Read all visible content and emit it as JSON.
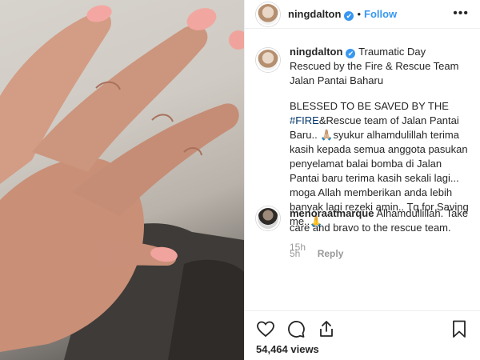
{
  "header": {
    "username": "ningdalton",
    "verified_glyph": "✔",
    "separator": "•",
    "follow_label": "Follow",
    "more_label": "•••"
  },
  "caption": {
    "username": "ningdalton",
    "verified_glyph": "✔",
    "title": "Traumatic Day Rescued by the Fire & Rescue Team Jalan Pantai Baharu",
    "body_prefix": "BLESSED TO BE SAVED BY THE ",
    "hashtag": "#FIRE",
    "body_rest": "&Rescue team of Jalan Pantai Baru.. 🙏🏼syukur alhamdulillah terima kasih kepada semua anggota pasukan penyelamat balai bomba di Jalan Pantai baru terima kasih sekali lagi... moga Allah memberikan anda lebih banyak lagi rezeki amin.. Tq for Saving me..🙏",
    "time": "15h"
  },
  "comment": {
    "username": "menoraatmarque",
    "text": "Alhamdullillah. Take care and bravo to the rescue team.",
    "time": "5h",
    "reply_label": "Reply"
  },
  "actions": {
    "like_icon": "heart-icon",
    "comment_icon": "comment-icon",
    "share_icon": "share-icon",
    "save_icon": "bookmark-icon",
    "views": "54,464 views"
  },
  "colors": {
    "link": "#3897f0",
    "hashtag": "#003569",
    "muted": "#999999",
    "text": "#262626"
  }
}
